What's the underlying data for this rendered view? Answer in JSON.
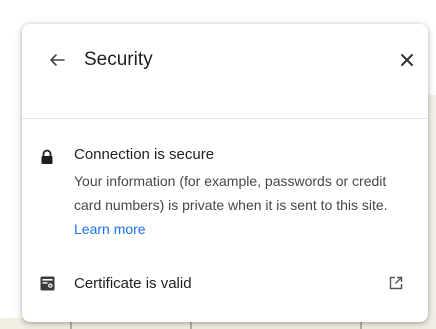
{
  "popup": {
    "title": "Security",
    "connection": {
      "title": "Connection is secure",
      "description": "Your information (for example, passwords or credit card numbers) is private when it is sent to this site.",
      "learn_more": "Learn more"
    },
    "certificate": {
      "label": "Certificate is valid"
    }
  },
  "icons": {
    "back": "back-arrow-icon",
    "close": "close-icon",
    "lock": "lock-icon",
    "certificate": "certificate-icon",
    "external": "open-external-icon"
  },
  "colors": {
    "link": "#1a73e8",
    "text_primary": "#1f1f1f",
    "text_secondary": "#474747",
    "background_accent": "#7b3fb8"
  }
}
